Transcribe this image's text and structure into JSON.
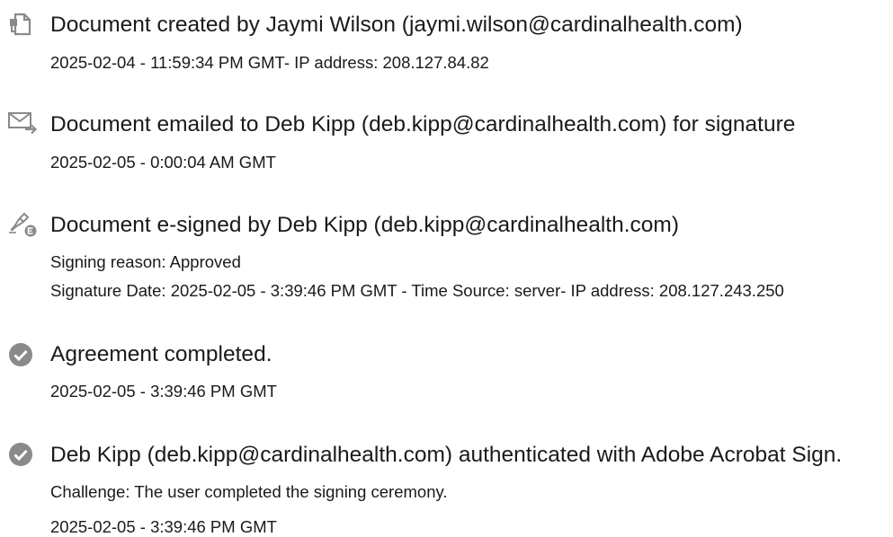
{
  "events": [
    {
      "icon": "document-created-icon",
      "title": "Document created by Jaymi Wilson (jaymi.wilson@cardinalhealth.com)",
      "details": [
        "2025-02-04 - 11:59:34 PM GMT- IP address: 208.127.84.82"
      ]
    },
    {
      "icon": "email-sent-icon",
      "title": "Document emailed to Deb Kipp (deb.kipp@cardinalhealth.com) for signature",
      "details": [
        "2025-02-05 - 0:00:04 AM GMT"
      ]
    },
    {
      "icon": "e-sign-pen-icon",
      "title": "Document e-signed by Deb Kipp (deb.kipp@cardinalhealth.com)",
      "details": [
        "Signing reason: Approved",
        "Signature Date: 2025-02-05 - 3:39:46 PM GMT - Time Source: server- IP address: 208.127.243.250"
      ]
    },
    {
      "icon": "checkmark-circle-icon",
      "title": "Agreement completed.",
      "details": [
        "2025-02-05 - 3:39:46 PM GMT"
      ]
    },
    {
      "icon": "checkmark-circle-icon",
      "title": "Deb Kipp (deb.kipp@cardinalhealth.com) authenticated with Adobe Acrobat Sign.",
      "details": [
        "Challenge: The user completed the signing ceremony.",
        "2025-02-05 - 3:39:46 PM GMT"
      ]
    }
  ],
  "colors": {
    "icon_gray": "#8a8a8a",
    "text": "#1a1a1a"
  }
}
